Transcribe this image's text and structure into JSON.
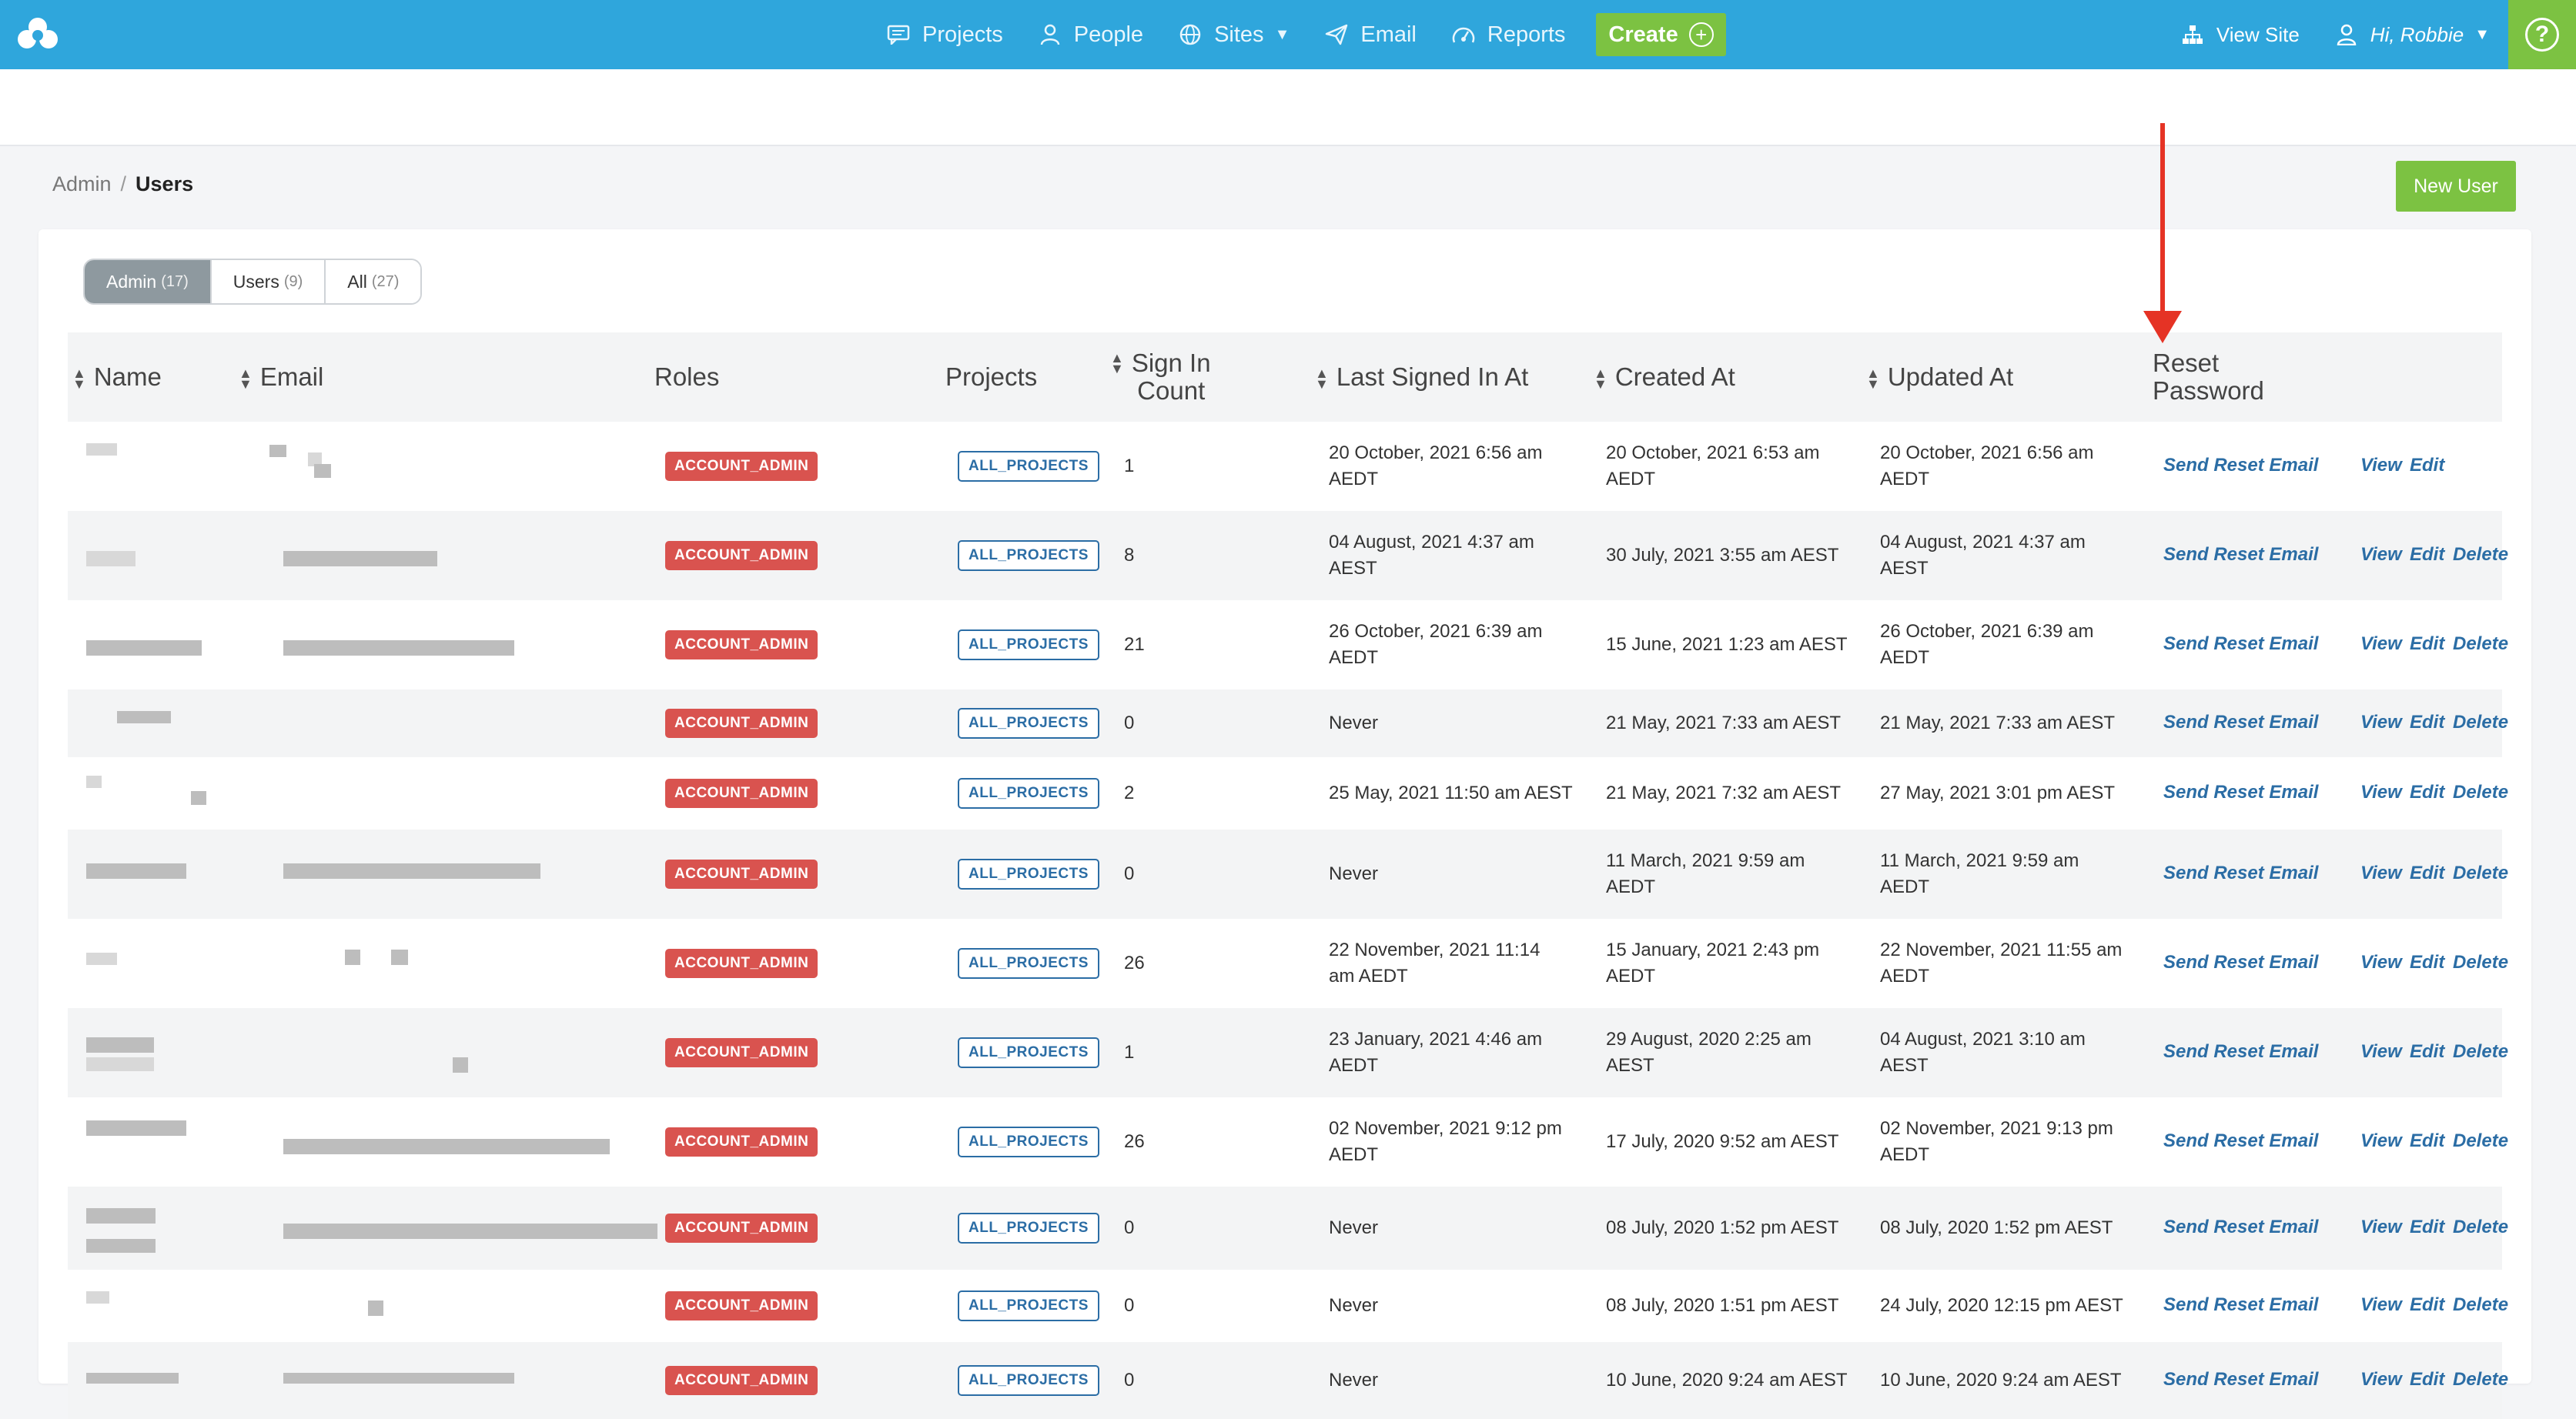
{
  "nav": {
    "items": [
      {
        "label": "Projects",
        "icon": "chat-icon"
      },
      {
        "label": "People",
        "icon": "person-icon"
      },
      {
        "label": "Sites",
        "icon": "globe-icon",
        "dropdown": true
      },
      {
        "label": "Email",
        "icon": "paper-plane-icon"
      },
      {
        "label": "Reports",
        "icon": "gauge-icon"
      }
    ],
    "create_label": "Create",
    "view_site_label": "View Site",
    "user_label": "Hi, Robbie",
    "help_label": "?"
  },
  "breadcrumb": {
    "parent": "Admin",
    "separator": "/",
    "current": "Users"
  },
  "new_user_label": "New User",
  "filters": [
    {
      "label": "Admin",
      "count": "(17)",
      "active": true
    },
    {
      "label": "Users",
      "count": "(9)",
      "active": false
    },
    {
      "label": "All",
      "count": "(27)",
      "active": false
    }
  ],
  "table": {
    "headers": {
      "name": "Name",
      "email": "Email",
      "roles": "Roles",
      "projects": "Projects",
      "sign_in_1": "Sign In",
      "sign_in_2": "Count",
      "last_signed": "Last Signed In At",
      "created": "Created At",
      "updated": "Updated At",
      "reset_1": "Reset",
      "reset_2": "Password"
    },
    "role_badge": "ACCOUNT_ADMIN",
    "project_badge": "ALL_PROJECTS",
    "actions": {
      "reset": "Send Reset Email",
      "view": "View",
      "edit": "Edit",
      "delete": "Delete"
    },
    "rows": [
      {
        "count": "1",
        "last": [
          "20 October, 2021 6:56 am",
          "AEDT"
        ],
        "created": [
          "20 October, 2021 6:53 am",
          "AEDT"
        ],
        "updated": [
          "20 October, 2021 6:56 am",
          "AEDT"
        ],
        "delete": false
      },
      {
        "count": "8",
        "last": [
          "04 August, 2021 4:37 am",
          "AEST"
        ],
        "created": [
          "30 July, 2021 3:55 am AEST"
        ],
        "updated": [
          "04 August, 2021 4:37 am",
          "AEST"
        ],
        "delete": true
      },
      {
        "count": "21",
        "last": [
          "26 October, 2021 6:39 am",
          "AEDT"
        ],
        "created": [
          "15 June, 2021 1:23 am AEST"
        ],
        "updated": [
          "26 October, 2021 6:39 am",
          "AEDT"
        ],
        "delete": true
      },
      {
        "count": "0",
        "last": [
          "Never"
        ],
        "created": [
          "21 May, 2021 7:33 am AEST"
        ],
        "updated": [
          "21 May, 2021 7:33 am AEST"
        ],
        "delete": true
      },
      {
        "count": "2",
        "last": [
          "25 May, 2021 11:50 am AEST"
        ],
        "created": [
          "21 May, 2021 7:32 am AEST"
        ],
        "updated": [
          "27 May, 2021 3:01 pm AEST"
        ],
        "delete": true
      },
      {
        "count": "0",
        "last": [
          "Never"
        ],
        "created": [
          "11 March, 2021 9:59 am",
          "AEDT"
        ],
        "updated": [
          "11 March, 2021 9:59 am",
          "AEDT"
        ],
        "delete": true
      },
      {
        "count": "26",
        "last": [
          "22 November, 2021 11:14",
          "am AEDT"
        ],
        "created": [
          "15 January, 2021 2:43 pm",
          "AEDT"
        ],
        "updated": [
          "22 November, 2021 11:55 am",
          "AEDT"
        ],
        "delete": true
      },
      {
        "count": "1",
        "last": [
          "23 January, 2021 4:46 am",
          "AEDT"
        ],
        "created": [
          "29 August, 2020 2:25 am",
          "AEST"
        ],
        "updated": [
          "04 August, 2021 3:10 am",
          "AEST"
        ],
        "delete": true
      },
      {
        "count": "26",
        "last": [
          "02 November, 2021 9:12 pm",
          "AEDT"
        ],
        "created": [
          "17 July, 2020 9:52 am AEST"
        ],
        "updated": [
          "02 November, 2021 9:13 pm",
          "AEDT"
        ],
        "delete": true
      },
      {
        "count": "0",
        "last": [
          "Never"
        ],
        "created": [
          "08 July, 2020 1:52 pm AEST"
        ],
        "updated": [
          "08 July, 2020 1:52 pm AEST"
        ],
        "delete": true
      },
      {
        "count": "0",
        "last": [
          "Never"
        ],
        "created": [
          "08 July, 2020 1:51 pm AEST"
        ],
        "updated": [
          "24 July, 2020 12:15 pm AEST"
        ],
        "delete": true
      },
      {
        "count": "0",
        "last": [
          "Never"
        ],
        "created": [
          "10 June, 2020 9:24 am AEST"
        ],
        "updated": [
          "10 June, 2020 9:24 am AEST"
        ],
        "delete": true
      }
    ]
  },
  "colors": {
    "topbar": "#2fa6dc",
    "accent_green": "#7cc242",
    "badge_red": "#d9534f",
    "link_blue": "#2b6da5",
    "annotation_arrow": "#e53325"
  }
}
